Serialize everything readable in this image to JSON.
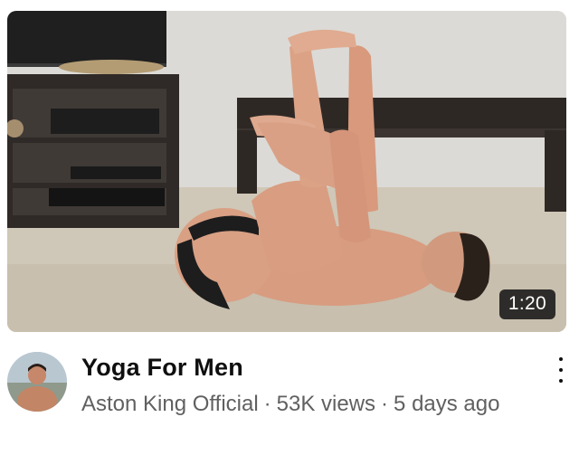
{
  "video": {
    "duration": "1:20",
    "title": "Yoga For Men",
    "channel": "Aston King Official",
    "views": "53K views",
    "age": "5 days ago",
    "separator": "·"
  },
  "icons": {
    "menu": "more-vertical-icon"
  }
}
